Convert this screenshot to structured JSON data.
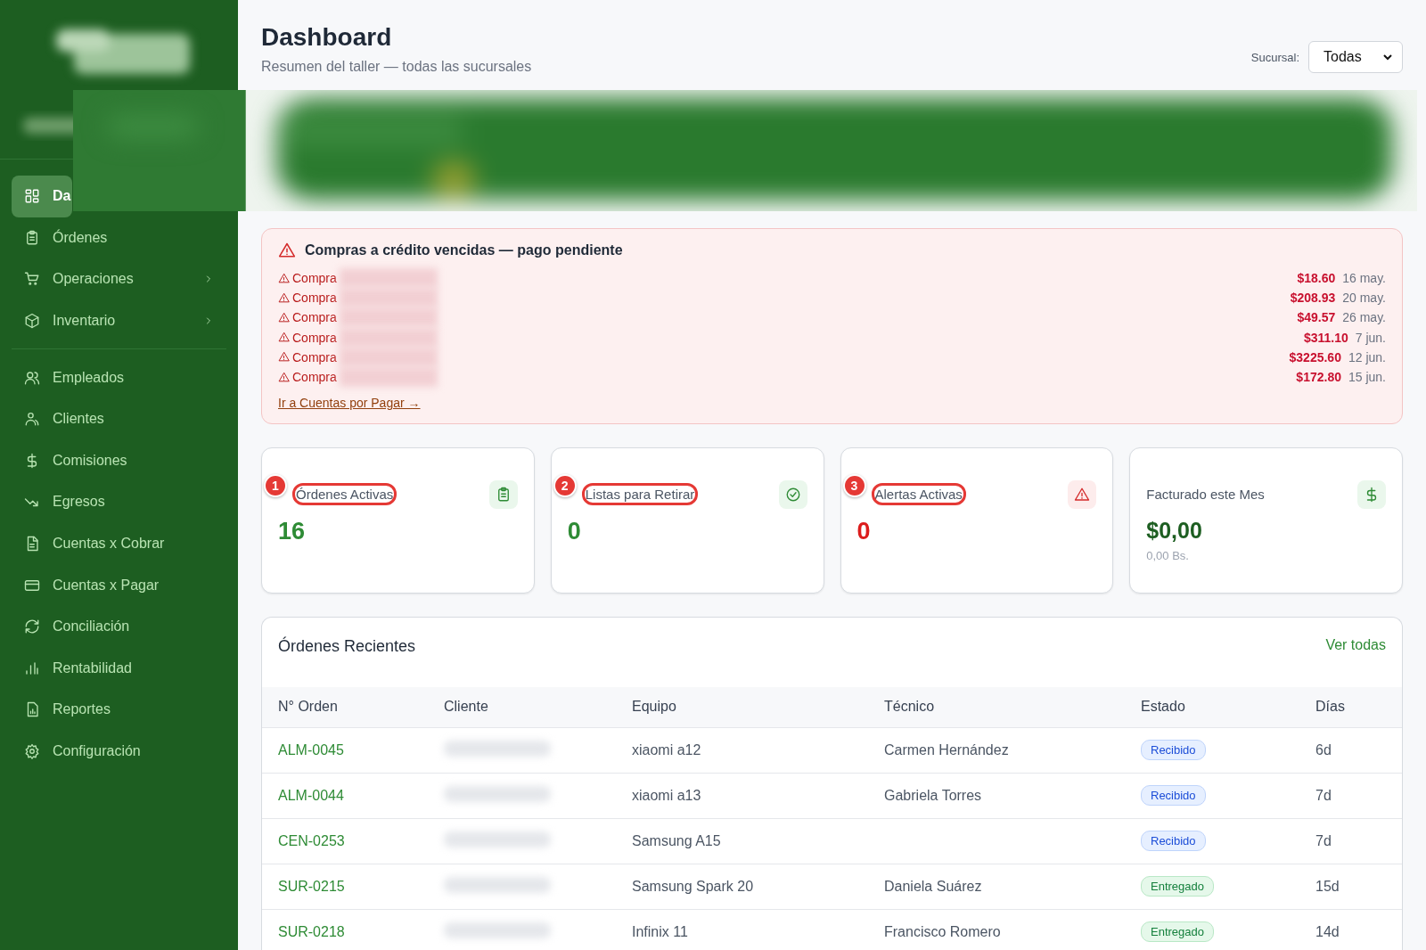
{
  "sidebar": {
    "groups": [
      [
        {
          "label": "Da",
          "selected": true,
          "has_submenu": false
        },
        {
          "label": "Órdenes",
          "selected": false,
          "has_submenu": false
        },
        {
          "label": "Operaciones",
          "selected": false,
          "has_submenu": true
        },
        {
          "label": "Inventario",
          "selected": false,
          "has_submenu": true
        }
      ],
      [
        {
          "label": "Empleados",
          "selected": false,
          "has_submenu": false
        },
        {
          "label": "Clientes",
          "selected": false,
          "has_submenu": false
        },
        {
          "label": "Comisiones",
          "selected": false,
          "has_submenu": false
        },
        {
          "label": "Egresos",
          "selected": false,
          "has_submenu": false
        },
        {
          "label": "Cuentas x Cobrar",
          "selected": false,
          "has_submenu": false
        },
        {
          "label": "Cuentas x Pagar",
          "selected": false,
          "has_submenu": false
        },
        {
          "label": "Conciliación",
          "selected": false,
          "has_submenu": false
        },
        {
          "label": "Rentabilidad",
          "selected": false,
          "has_submenu": false
        },
        {
          "label": "Reportes",
          "selected": false,
          "has_submenu": false
        },
        {
          "label": "Configuración",
          "selected": false,
          "has_submenu": false
        }
      ]
    ]
  },
  "header": {
    "title": "Dashboard",
    "subtitle": "Resumen del taller — todas las sucursales",
    "branch_label": "Sucursal:",
    "branch_value": "Todas"
  },
  "alert": {
    "title": "Compras a crédito vencidas — pago pendiente",
    "items": [
      {
        "label": "Compra",
        "amount": "$18.60",
        "date": "16 may."
      },
      {
        "label": "Compra",
        "amount": "$208.93",
        "date": "20 may."
      },
      {
        "label": "Compra",
        "amount": "$49.57",
        "date": "26 may."
      },
      {
        "label": "Compra",
        "amount": "$311.10",
        "date": "7 jun."
      },
      {
        "label": "Compra",
        "amount": "$3225.60",
        "date": "12 jun."
      },
      {
        "label": "Compra",
        "amount": "$172.80",
        "date": "15 jun."
      }
    ],
    "link": "Ir a Cuentas por Pagar →"
  },
  "stats": [
    {
      "label": "Órdenes Activas",
      "value": "16",
      "kind": "count",
      "annotation": "1"
    },
    {
      "label": "Listas para Retirar",
      "value": "0",
      "kind": "ready",
      "annotation": "2"
    },
    {
      "label": "Alertas Activas",
      "value": "0",
      "kind": "alert",
      "annotation": "3"
    },
    {
      "label": "Facturado este Mes",
      "value": "$0,00",
      "kind": "money",
      "sub": "0,00 Bs."
    }
  ],
  "recent_orders": {
    "title": "Órdenes Recientes",
    "link": "Ver todas",
    "columns": [
      "N° Orden",
      "Cliente",
      "Equipo",
      "Técnico",
      "Estado",
      "Días"
    ],
    "rows": [
      {
        "order": "ALM-0045",
        "device": "xiaomi a12",
        "technician": "Carmen Hernández",
        "status": "Recibido",
        "kind": "received",
        "days": "6d"
      },
      {
        "order": "ALM-0044",
        "device": "xiaomi a13",
        "technician": "Gabriela Torres",
        "status": "Recibido",
        "kind": "received",
        "days": "7d"
      },
      {
        "order": "CEN-0253",
        "device": "Samsung A15",
        "status": "Recibido",
        "kind": "received",
        "days": "7d"
      },
      {
        "order": "SUR-0215",
        "device": "Samsung Spark 20",
        "technician": "Daniela Suárez",
        "status": "Entregado",
        "kind": "delivered",
        "days": "15d"
      },
      {
        "order": "SUR-0218",
        "device": "Infinix 11",
        "technician": "Francisco Romero",
        "status": "Entregado",
        "kind": "delivered",
        "days": "14d"
      }
    ]
  }
}
